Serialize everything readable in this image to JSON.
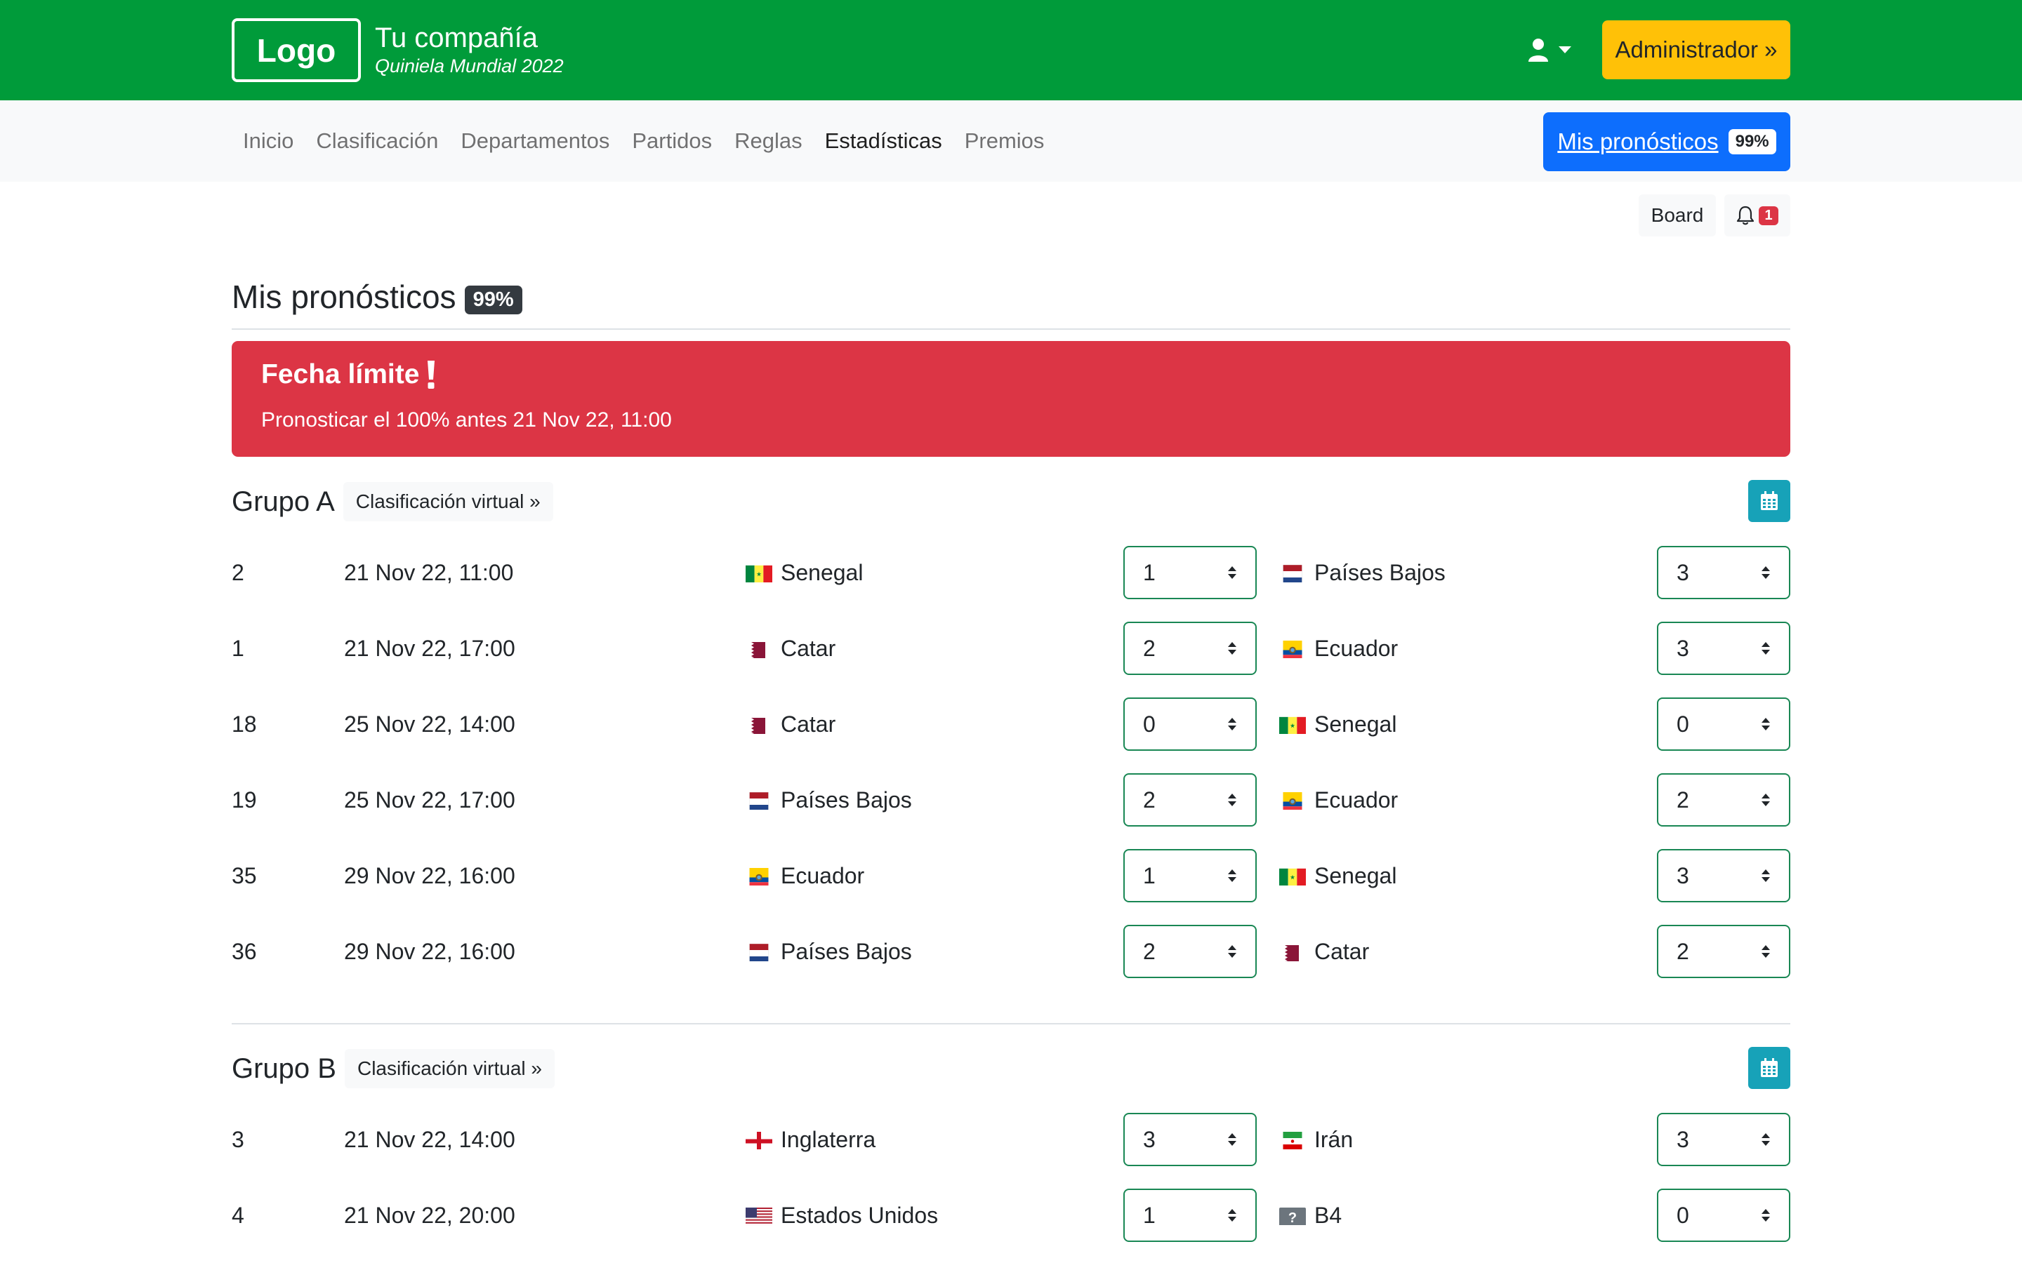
{
  "header": {
    "logo": "Logo",
    "company_name": "Tu compañía",
    "company_sub": "Quiniela Mundial 2022",
    "user_icon": "user-icon",
    "admin_label": "Administrador »"
  },
  "nav": {
    "items": [
      {
        "label": "Inicio",
        "active": false
      },
      {
        "label": "Clasificación",
        "active": false
      },
      {
        "label": "Departamentos",
        "active": false
      },
      {
        "label": "Partidos",
        "active": false
      },
      {
        "label": "Reglas",
        "active": false
      },
      {
        "label": "Estadísticas",
        "active": true
      },
      {
        "label": "Premios",
        "active": false
      }
    ],
    "mis_label": "Mis pronósticos",
    "mis_badge": "99%"
  },
  "toolbar": {
    "board_label": "Board",
    "bell_count": "1"
  },
  "page": {
    "title": "Mis pronósticos",
    "badge": "99%"
  },
  "alert": {
    "heading": "Fecha límite",
    "text": "Pronosticar el 100% antes 21 Nov 22, 11:00",
    "color": "#dc3545"
  },
  "groups": [
    {
      "name": "Grupo A",
      "virtual_label": "Clasificación virtual »",
      "matches": [
        {
          "num": "2",
          "date": "21 Nov 22, 11:00",
          "home": "Senegal",
          "home_flag": "sn",
          "home_score": "1",
          "away": "Países Bajos",
          "away_flag": "nl",
          "away_score": "3"
        },
        {
          "num": "1",
          "date": "21 Nov 22, 17:00",
          "home": "Catar",
          "home_flag": "qa",
          "home_score": "2",
          "away": "Ecuador",
          "away_flag": "ec",
          "away_score": "3"
        },
        {
          "num": "18",
          "date": "25 Nov 22, 14:00",
          "home": "Catar",
          "home_flag": "qa",
          "home_score": "0",
          "away": "Senegal",
          "away_flag": "sn",
          "away_score": "0"
        },
        {
          "num": "19",
          "date": "25 Nov 22, 17:00",
          "home": "Países Bajos",
          "home_flag": "nl",
          "home_score": "2",
          "away": "Ecuador",
          "away_flag": "ec",
          "away_score": "2"
        },
        {
          "num": "35",
          "date": "29 Nov 22, 16:00",
          "home": "Ecuador",
          "home_flag": "ec",
          "home_score": "1",
          "away": "Senegal",
          "away_flag": "sn",
          "away_score": "3"
        },
        {
          "num": "36",
          "date": "29 Nov 22, 16:00",
          "home": "Países Bajos",
          "home_flag": "nl",
          "home_score": "2",
          "away": "Catar",
          "away_flag": "qa",
          "away_score": "2"
        }
      ]
    },
    {
      "name": "Grupo B",
      "virtual_label": "Clasificación virtual »",
      "matches": [
        {
          "num": "3",
          "date": "21 Nov 22, 14:00",
          "home": "Inglaterra",
          "home_flag": "en",
          "home_score": "3",
          "away": "Irán",
          "away_flag": "ir",
          "away_score": "3"
        },
        {
          "num": "4",
          "date": "21 Nov 22, 20:00",
          "home": "Estados Unidos",
          "home_flag": "us",
          "home_score": "1",
          "away": "B4",
          "away_flag": "unknown",
          "away_score": "0"
        }
      ]
    }
  ],
  "colors": {
    "header_green": "#009b3a",
    "admin_yellow": "#ffc107",
    "primary_blue": "#0d6efd",
    "select_border_green": "#198754",
    "calendar_teal": "#17a2b8"
  }
}
